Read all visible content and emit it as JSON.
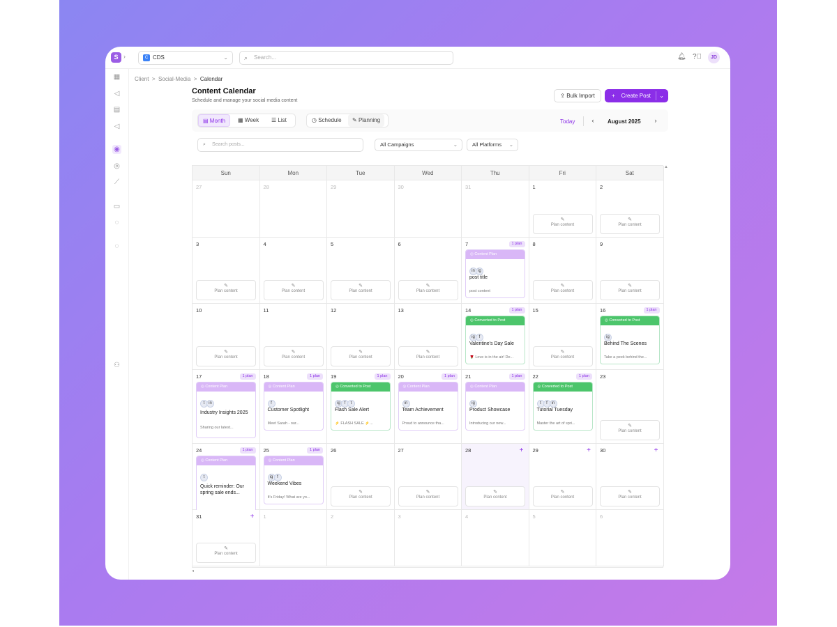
{
  "topbar": {
    "logo": "S",
    "workspace": {
      "icon": "C",
      "label": "CDS"
    },
    "search_placeholder": "Search...",
    "avatar": "JD"
  },
  "breadcrumb": {
    "items": [
      "Client",
      "Social-Media",
      "Calendar"
    ],
    "sep": ">"
  },
  "page": {
    "title": "Content Calendar",
    "subtitle": "Schedule and manage your social media content",
    "bulk_import": "Bulk Import",
    "create_post": "Create Post"
  },
  "toolbar": {
    "views": [
      "Month",
      "Week",
      "List"
    ],
    "modes": [
      "Schedule",
      "Planning"
    ],
    "today": "Today",
    "month_label": "August 2025"
  },
  "filters": {
    "search_placeholder": "Search posts...",
    "campaigns": "All Campaigns",
    "platforms": "All Platforms"
  },
  "calendar": {
    "days_of_week": [
      "Sun",
      "Mon",
      "Tue",
      "Wed",
      "Thu",
      "Fri",
      "Sat"
    ],
    "plan_label": "Plan content",
    "badge_label": "1 plan",
    "weeks": [
      [
        {
          "d": "27",
          "muted": true
        },
        {
          "d": "28",
          "muted": true
        },
        {
          "d": "29",
          "muted": true
        },
        {
          "d": "30",
          "muted": true
        },
        {
          "d": "31",
          "muted": true
        },
        {
          "d": "1",
          "plan": true
        },
        {
          "d": "2",
          "plan": true
        }
      ],
      [
        {
          "d": "3",
          "plan": true
        },
        {
          "d": "4",
          "plan": true
        },
        {
          "d": "5",
          "plan": true
        },
        {
          "d": "6",
          "plan": true
        },
        {
          "d": "7",
          "badge": true,
          "card": {
            "status": "cp",
            "header": "Content Plan",
            "icons": [
              "in",
              "ig"
            ],
            "title": "post title",
            "desc": "post content"
          }
        },
        {
          "d": "8",
          "plan": true
        },
        {
          "d": "9",
          "plan": true
        }
      ],
      [
        {
          "d": "10",
          "plan": true
        },
        {
          "d": "11",
          "plan": true
        },
        {
          "d": "12",
          "plan": true
        },
        {
          "d": "13",
          "plan": true
        },
        {
          "d": "14",
          "badge": true,
          "card": {
            "status": "conv",
            "header": "Converted to Post",
            "icons": [
              "ig",
              "f"
            ],
            "title": "Valentine's Day Sale",
            "desc": "🌹 Love is in the air! De..."
          }
        },
        {
          "d": "15",
          "plan": true
        },
        {
          "d": "16",
          "badge": true,
          "card": {
            "status": "conv",
            "header": "Converted to Post",
            "icons": [
              "ig"
            ],
            "title": "Behind The Scenes",
            "desc": "Take a peek behind the..."
          }
        }
      ],
      [
        {
          "d": "17",
          "badge": true,
          "card": {
            "status": "cp",
            "header": "Content Plan",
            "icons": [
              "t",
              "in"
            ],
            "title": "Industry Insights 2025",
            "desc": "Sharing our latest...",
            "tall": true
          }
        },
        {
          "d": "18",
          "badge": true,
          "card": {
            "status": "cp",
            "header": "Content Plan",
            "icons": [
              "f"
            ],
            "title": "Customer Spotlight",
            "desc": "Meet Sarah - our..."
          }
        },
        {
          "d": "19",
          "badge": true,
          "card": {
            "status": "conv",
            "header": "Converted to Post",
            "icons": [
              "ig",
              "f",
              "t"
            ],
            "title": "Flash Sale Alert",
            "desc": "⚡ FLASH SALE ⚡..."
          }
        },
        {
          "d": "20",
          "badge": true,
          "card": {
            "status": "cp",
            "header": "Content Plan",
            "icons": [
              "in"
            ],
            "title": "Team Achievement",
            "desc": "Proud to announce tha..."
          }
        },
        {
          "d": "21",
          "badge": true,
          "card": {
            "status": "cp",
            "header": "Content Plan",
            "icons": [
              "ig"
            ],
            "title": "Product Showcase",
            "desc": "Introducing our new..."
          }
        },
        {
          "d": "22",
          "badge": true,
          "card": {
            "status": "conv",
            "header": "Converted to Post",
            "icons": [
              "t",
              "f",
              "in"
            ],
            "title": "Tutorial Tuesday",
            "desc": "Master the art of spri..."
          }
        },
        {
          "d": "23",
          "plan": true
        }
      ],
      [
        {
          "d": "24",
          "badge": true,
          "card": {
            "status": "cp",
            "header": "Content Plan",
            "icons": [
              "t"
            ],
            "title": "Quick reminder: Our spring sale ends...",
            "desc": "",
            "tall": true
          }
        },
        {
          "d": "25",
          "badge": true,
          "card": {
            "status": "cp",
            "header": "Content Plan",
            "icons": [
              "ig",
              "f"
            ],
            "title": "Weekend Vibes",
            "desc": "It's Friday! What are yo..."
          }
        },
        {
          "d": "26",
          "plan": true
        },
        {
          "d": "27",
          "plan": true
        },
        {
          "d": "28",
          "plan": true,
          "plus": true,
          "hl": true
        },
        {
          "d": "29",
          "plan": true,
          "plus": true
        },
        {
          "d": "30",
          "plan": true,
          "plus": true
        }
      ],
      [
        {
          "d": "31",
          "plan": true,
          "plus": true
        },
        {
          "d": "1",
          "muted": true
        },
        {
          "d": "2",
          "muted": true
        },
        {
          "d": "3",
          "muted": true
        },
        {
          "d": "4",
          "muted": true
        },
        {
          "d": "5",
          "muted": true
        },
        {
          "d": "6",
          "muted": true
        }
      ]
    ]
  },
  "colors": {
    "accent": "#8b2ee8",
    "plan_header": "#d9b7f7",
    "converted_header": "#4cc56b"
  }
}
